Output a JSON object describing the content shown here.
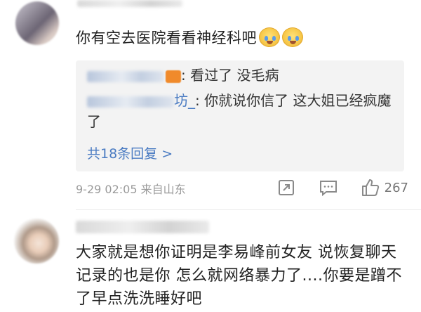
{
  "comment1": {
    "text": "你有空去医院看看神经科吧",
    "emojis": [
      "crying-face-icon",
      "crying-face-icon"
    ],
    "replies": [
      {
        "text": "看过了 没毛病"
      },
      {
        "name_tail": "坊_",
        "text": "你就说你信了 这大姐已经疯魔了"
      }
    ],
    "more_replies": "共18条回复 >",
    "meta": "9-29 02:05 来自山东",
    "like_count": "267"
  },
  "comment2": {
    "text": "大家就是想你证明是李易峰前女友 说恢复聊天记录的也是你 怎么就网络暴力了....你要是蹭不了早点洗洗睡好吧"
  }
}
